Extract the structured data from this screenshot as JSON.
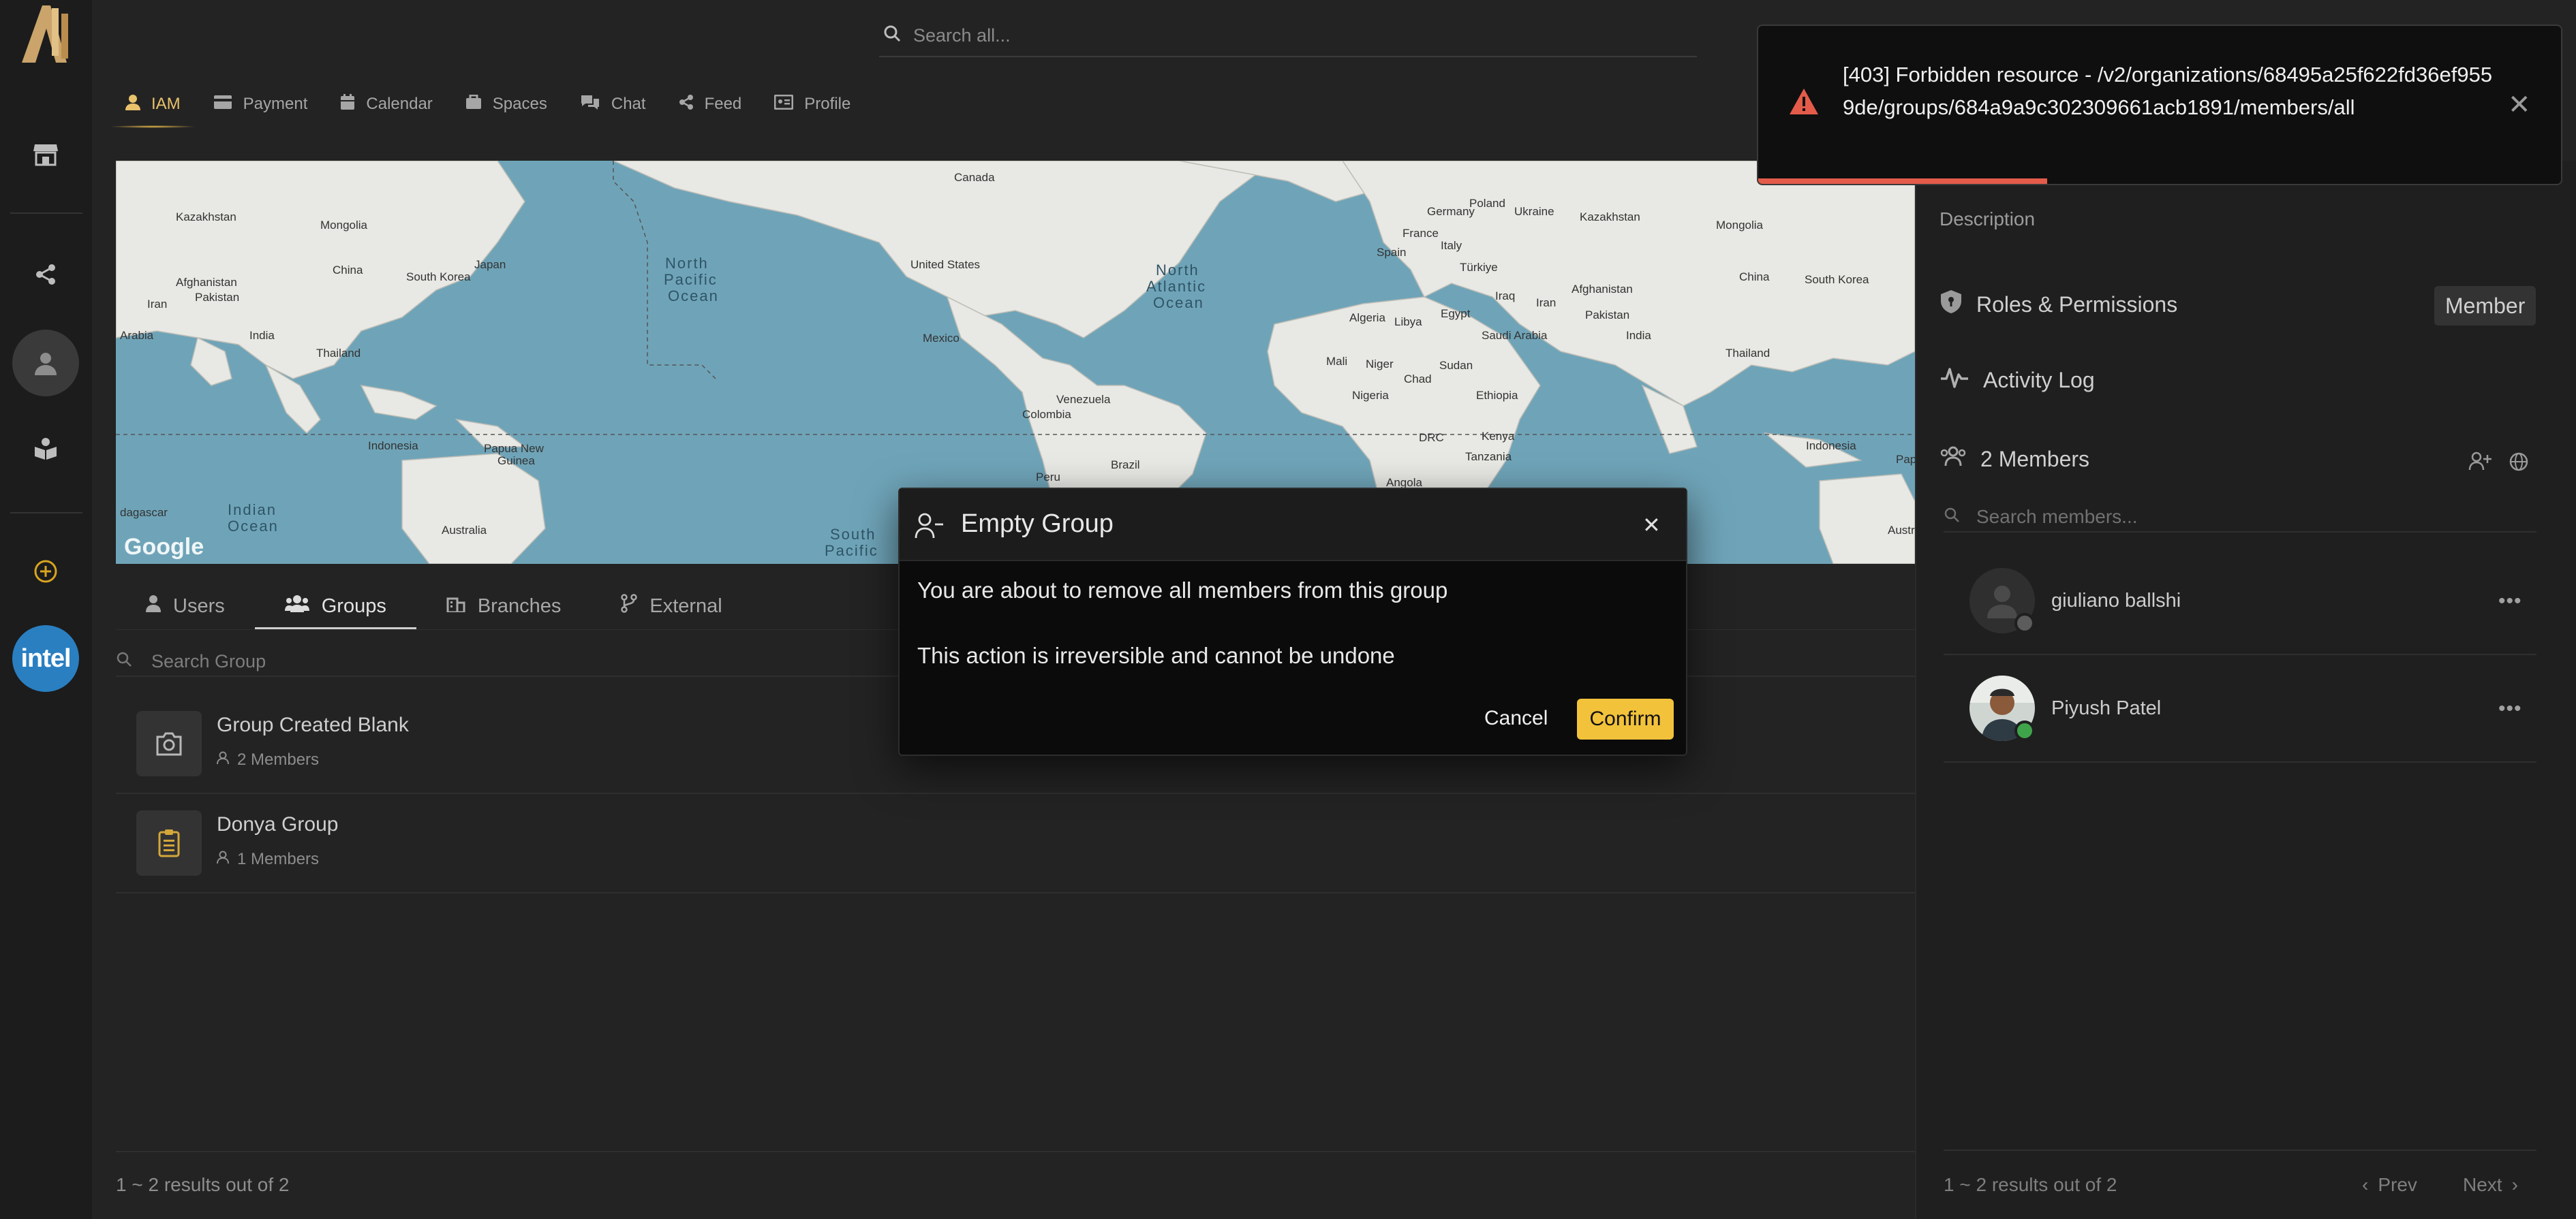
{
  "top_search": {
    "placeholder": "Search all..."
  },
  "nav": {
    "tabs": [
      {
        "label": "IAM",
        "active": true,
        "icon": "user-icon"
      },
      {
        "label": "Payment",
        "icon": "card-icon"
      },
      {
        "label": "Calendar",
        "icon": "calendar-icon"
      },
      {
        "label": "Spaces",
        "icon": "spaces-icon"
      },
      {
        "label": "Chat",
        "icon": "chat-icon"
      },
      {
        "label": "Feed",
        "icon": "share-icon"
      },
      {
        "label": "Profile",
        "icon": "id-card-icon"
      }
    ]
  },
  "rail": {
    "org_badge": "intel"
  },
  "map": {
    "labels": [
      "Kazakhstan",
      "Mongolia",
      "China",
      "Japan",
      "South Korea",
      "Afghanistan",
      "Pakistan",
      "Iran",
      "India",
      "Arabia",
      "Thailand",
      "Indonesia",
      "Papua New Guinea",
      "Australia",
      "Indian Ocean",
      "dagascar",
      "North Pacific Ocean",
      "Canada",
      "United States",
      "Mexico",
      "North Atlantic Ocean",
      "Venezuela",
      "Colombia",
      "Peru",
      "Brazil",
      "South Pacific",
      "Germany",
      "Poland",
      "Ukraine",
      "Kazakhstan",
      "France",
      "Spain",
      "Italy",
      "Türkiye",
      "Mongolia",
      "China",
      "Algeria",
      "Libya",
      "Egypt",
      "Iraq",
      "Iran",
      "Afghanistan",
      "Pakistan",
      "India",
      "Saudi Arabia",
      "Mali",
      "Niger",
      "Sudan",
      "Chad",
      "Nigeria",
      "Ethiopia",
      "DRC",
      "Kenya",
      "Tanzania",
      "Angola",
      "South Korea",
      "Thailand",
      "Indonesia",
      "Australia",
      "Papua New Gui"
    ],
    "watermark": "Google"
  },
  "subtabs": [
    {
      "label": "Users",
      "icon": "user-icon"
    },
    {
      "label": "Groups",
      "icon": "users-icon",
      "active": true
    },
    {
      "label": "Branches",
      "icon": "building-icon"
    },
    {
      "label": "External",
      "icon": "branch-icon"
    }
  ],
  "group_search": {
    "placeholder": "Search Group"
  },
  "groups": [
    {
      "name": "Group Created Blank",
      "members": "2 Members",
      "icon": "camera-icon"
    },
    {
      "name": "Donya Group",
      "members": "1 Members",
      "icon": "clipboard-icon"
    }
  ],
  "left_results": "1 ~ 2 results out of 2",
  "right_panel": {
    "description_label": "Description",
    "roles_label": "Roles & Permissions",
    "role_badge": "Member",
    "activity_label": "Activity Log",
    "members_label": "2 Members",
    "members_search_placeholder": "Search members...",
    "members": [
      {
        "name": "giuliano ballshi",
        "status": "offline"
      },
      {
        "name": "Piyush Patel",
        "status": "online"
      }
    ],
    "results": "1 ~ 2 results out of 2",
    "prev": "Prev",
    "next": "Next"
  },
  "toast": {
    "message": "[403] Forbidden resource - /v2/organizations/68495a25f622fd36ef9559de/groups/684a9a9c302309661acb1891/members/all",
    "progress": 0.36,
    "accent": "#e45b4a"
  },
  "dialog": {
    "title": "Empty Group",
    "line1": "You are about to remove all members from this group",
    "line2": "This action is irreversible and cannot be undone",
    "cancel": "Cancel",
    "confirm": "Confirm",
    "confirm_color": "#f2c23b"
  }
}
